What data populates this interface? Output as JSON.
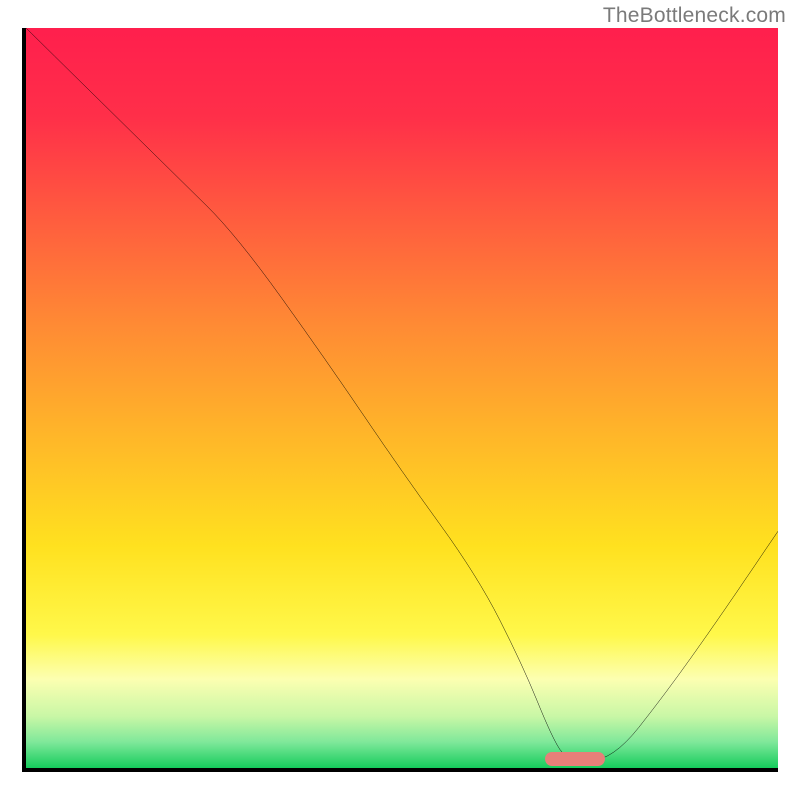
{
  "watermark": "TheBottleneck.com",
  "chart_data": {
    "type": "line",
    "title": "",
    "xlabel": "",
    "ylabel": "",
    "xlim": [
      0,
      100
    ],
    "ylim": [
      0,
      100
    ],
    "grid": false,
    "legend": false,
    "x": [
      0,
      10,
      20,
      28,
      40,
      50,
      60,
      66,
      70,
      72,
      78,
      85,
      92,
      100
    ],
    "y": [
      100,
      90,
      80,
      72,
      55,
      40,
      26,
      14,
      4,
      1,
      1,
      10,
      20,
      32
    ],
    "marker": {
      "x0": 69,
      "x1": 77,
      "y": 1.2
    },
    "gradient_stops": [
      {
        "pos": 0.0,
        "color": "#ff1f4d"
      },
      {
        "pos": 0.12,
        "color": "#ff2f49"
      },
      {
        "pos": 0.25,
        "color": "#ff5a3f"
      },
      {
        "pos": 0.4,
        "color": "#ff8a34"
      },
      {
        "pos": 0.55,
        "color": "#ffb629"
      },
      {
        "pos": 0.7,
        "color": "#ffe11f"
      },
      {
        "pos": 0.82,
        "color": "#fff84a"
      },
      {
        "pos": 0.88,
        "color": "#fcffb1"
      },
      {
        "pos": 0.93,
        "color": "#c9f7a6"
      },
      {
        "pos": 0.965,
        "color": "#7fe89a"
      },
      {
        "pos": 1.0,
        "color": "#15cc5c"
      }
    ]
  }
}
